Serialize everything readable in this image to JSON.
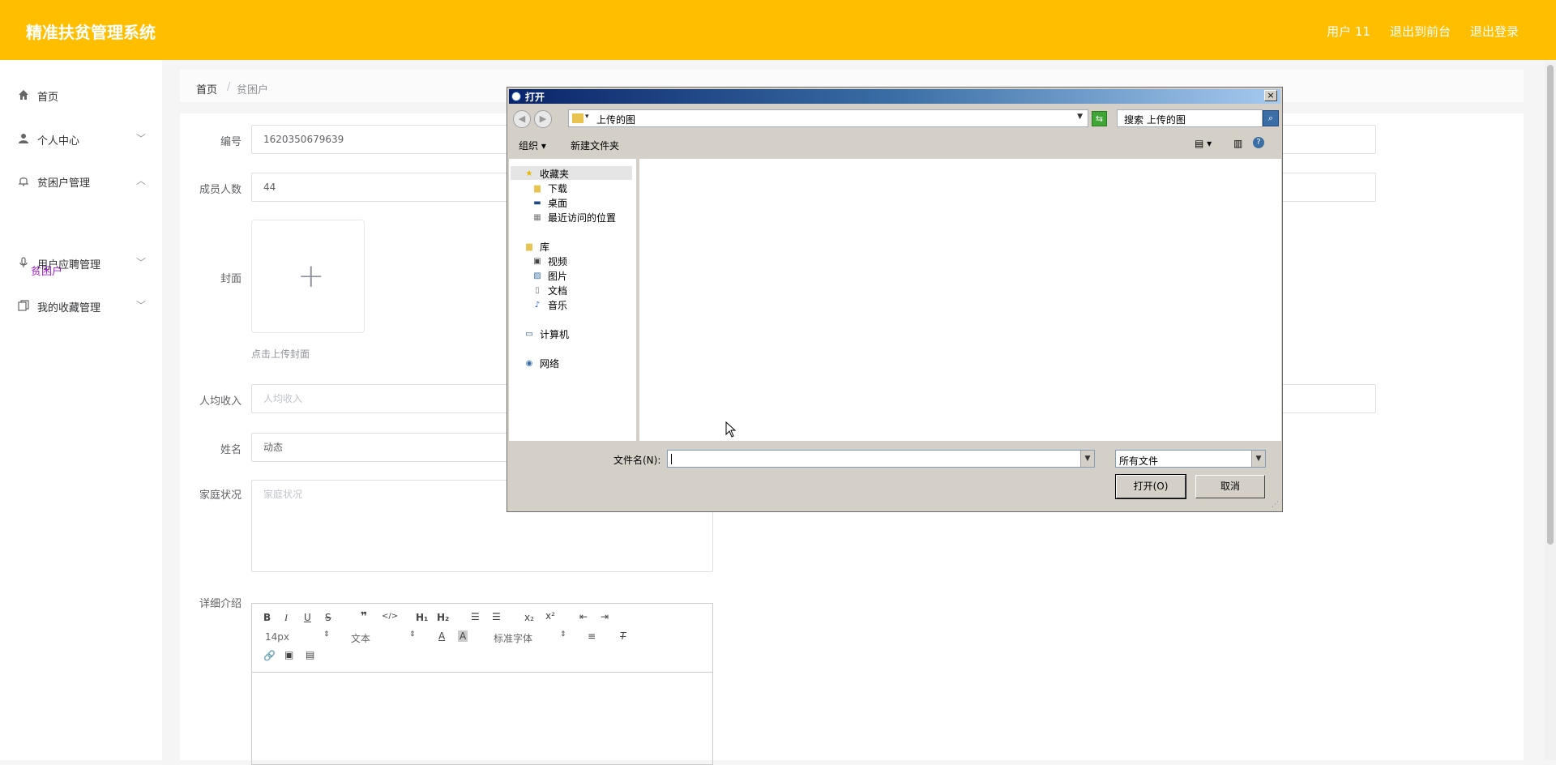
{
  "app": {
    "title": "精准扶贫管理系统",
    "header_links": [
      "用户 11",
      "退出到前台",
      "退出登录"
    ]
  },
  "sidebar": {
    "items": [
      {
        "label": "首页",
        "icon": "home-icon"
      },
      {
        "label": "个人中心",
        "icon": "user-icon"
      },
      {
        "label": "贫困户管理",
        "icon": "bell-icon"
      },
      {
        "label": "用户应聘管理",
        "icon": "microphone-icon"
      },
      {
        "label": "我的收藏管理",
        "icon": "copy-icon"
      }
    ],
    "sub_item": "贫困户"
  },
  "breadcrumb": {
    "home": "首页",
    "sep": "/",
    "current": "贫困户"
  },
  "form": {
    "labels": {
      "code": "编号",
      "members": "成员人数",
      "cover": "封面",
      "income": "人均收入",
      "name": "姓名",
      "family": "家庭状况",
      "detail": "详细介绍"
    },
    "values": {
      "code": "1620350679639",
      "members": "44",
      "name": "动态"
    },
    "placeholders": {
      "income": "人均收入",
      "family": "家庭状况"
    },
    "upload_hint": "点击上传封面"
  },
  "editor": {
    "font_size": "14px",
    "text_style": "文本",
    "font_family": "标准字体"
  },
  "dialog": {
    "title": "打开",
    "close": "×",
    "current_folder": "上传的图",
    "search_placeholder": "搜索 上传的图",
    "organize": "组织",
    "new_folder": "新建文件夹",
    "tree": [
      {
        "label": "收藏夹",
        "icon": "star-icon",
        "level": 0
      },
      {
        "label": "下载",
        "icon": "folder-icon",
        "level": 1
      },
      {
        "label": "桌面",
        "icon": "desktop-icon",
        "level": 1
      },
      {
        "label": "最近访问的位置",
        "icon": "recent-icon",
        "level": 1
      },
      {
        "label": "库",
        "icon": "library-icon",
        "level": 0
      },
      {
        "label": "视频",
        "icon": "video-icon",
        "level": 1
      },
      {
        "label": "图片",
        "icon": "picture-icon",
        "level": 1
      },
      {
        "label": "文档",
        "icon": "document-icon",
        "level": 1
      },
      {
        "label": "音乐",
        "icon": "music-icon",
        "level": 1
      },
      {
        "label": "计算机",
        "icon": "computer-icon",
        "level": 0
      },
      {
        "label": "网络",
        "icon": "network-icon",
        "level": 0
      }
    ],
    "filename_label": "文件名(N):",
    "filename_value": "",
    "filetype": "所有文件",
    "open_button": "打开(O)",
    "cancel_button": "取消"
  },
  "colors": {
    "header": "#ffbe00",
    "active_sub": "#a31ad1"
  }
}
